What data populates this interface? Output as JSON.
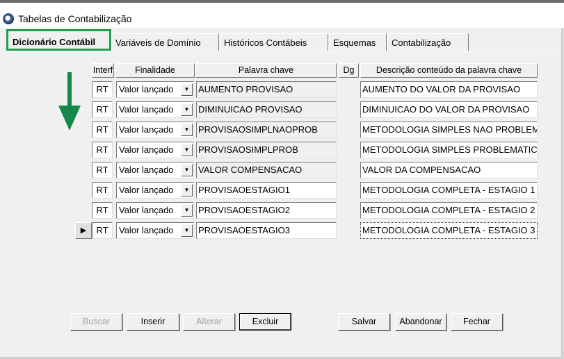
{
  "window": {
    "title": "Tabelas de Contabilização"
  },
  "tabs": [
    {
      "label": "Dicionário Contábil",
      "active": true
    },
    {
      "label": "Variáveis de Domínio",
      "active": false
    },
    {
      "label": "Históricos Contábeis",
      "active": false
    },
    {
      "label": "Esquemas",
      "active": false
    },
    {
      "label": "Contabilização",
      "active": false
    }
  ],
  "grid": {
    "columns": [
      "Interf",
      "Finalidade",
      "Palavra chave",
      "Dg",
      "Descrição conteúdo da palavra chave"
    ],
    "rows": [
      {
        "interf": "RT",
        "finalidade": "Valor lançado",
        "palavra": "AUMENTO PROVISAO",
        "descricao": "AUMENTO DO VALOR DA PROVISAO"
      },
      {
        "interf": "RT",
        "finalidade": "Valor lançado",
        "palavra": "DIMINUICAO PROVISAO",
        "descricao": "DIMINUICAO DO VALOR DA PROVISAO"
      },
      {
        "interf": "RT",
        "finalidade": "Valor lançado",
        "palavra": "PROVISAOSIMPLNAOPROB",
        "descricao": "METODOLOGIA SIMPLES NAO PROBLEMATICO"
      },
      {
        "interf": "RT",
        "finalidade": "Valor lançado",
        "palavra": "PROVISAOSIMPLPROB",
        "descricao": "METODOLOGIA SIMPLES PROBLEMATICO"
      },
      {
        "interf": "RT",
        "finalidade": "Valor lançado",
        "palavra": "VALOR COMPENSACAO",
        "descricao": "VALOR DA COMPENSACAO"
      },
      {
        "interf": "RT",
        "finalidade": "Valor lançado",
        "palavra": "PROVISAOESTAGIO1",
        "descricao": "METODOLOGIA COMPLETA - ESTAGIO 1"
      },
      {
        "interf": "RT",
        "finalidade": "Valor lançado",
        "palavra": "PROVISAOESTAGIO2",
        "descricao": "METODOLOGIA COMPLETA - ESTAGIO 2"
      },
      {
        "interf": "RT",
        "finalidade": "Valor lançado",
        "palavra": "PROVISAOESTAGIO3",
        "descricao": "METODOLOGIA COMPLETA - ESTAGIO 3"
      }
    ]
  },
  "buttons": {
    "buscar": "Buscar",
    "inserir": "Inserir",
    "alterar": "Alterar",
    "excluir": "Excluir",
    "salvar": "Salvar",
    "abandonar": "Abandonar",
    "fechar": "Fechar"
  },
  "icons": {
    "app": "app-logo-icon",
    "dropdown": "dropdown-arrow-icon",
    "row_pointer": "row-pointer-icon",
    "annotation": "green-down-arrow-icon"
  },
  "colors": {
    "highlight_box": "#1e9e48",
    "arrow": "#14874a",
    "window_bg": "#f0f0f0"
  }
}
